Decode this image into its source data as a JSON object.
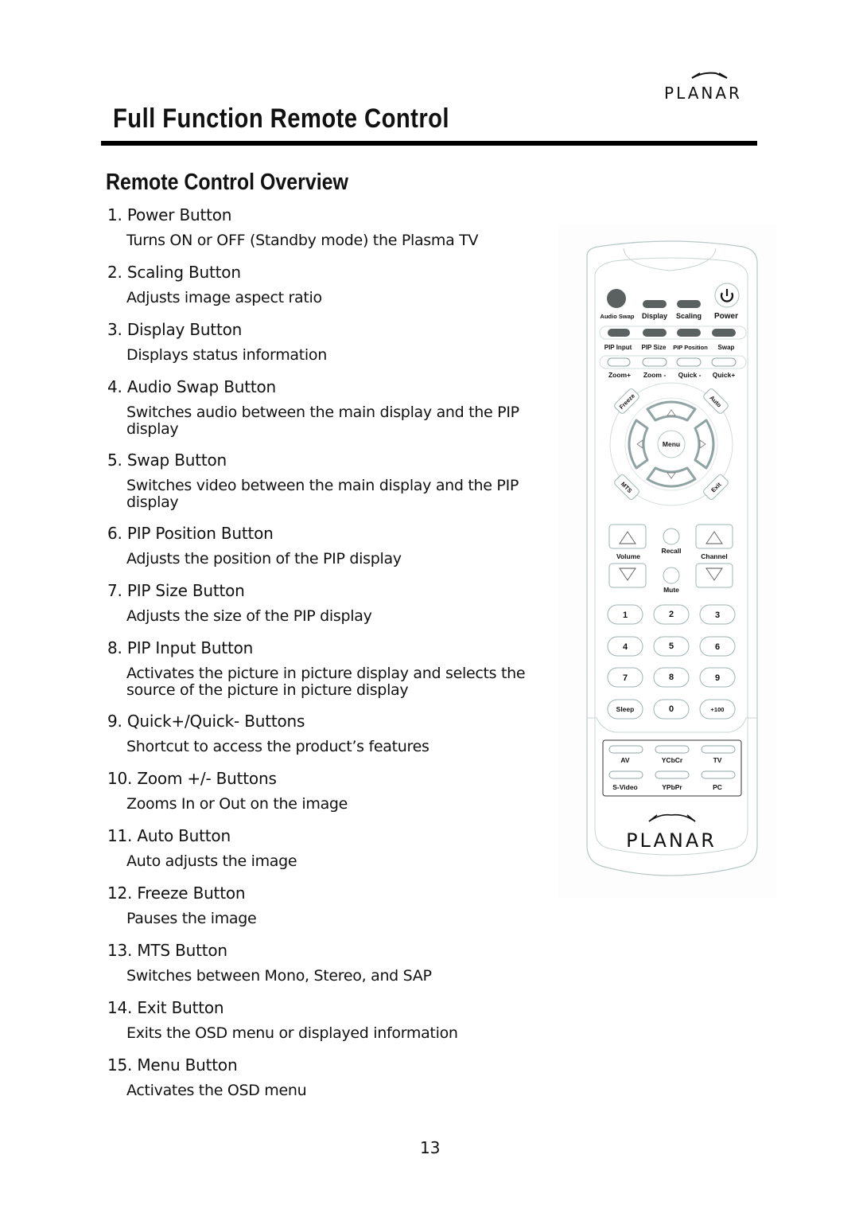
{
  "header": {
    "brand": "PLANAR",
    "title": "Full Function Remote Control"
  },
  "section": {
    "title": "Remote Control Overview"
  },
  "items": [
    {
      "heading": "1. Power Button",
      "description": "Turns ON or OFF (Standby mode) the Plasma TV"
    },
    {
      "heading": "2. Scaling Button",
      "description": "Adjusts image aspect ratio"
    },
    {
      "heading": "3. Display Button",
      "description": "Displays status information"
    },
    {
      "heading": "4. Audio Swap Button",
      "description": "Switches audio between the main display and the PIP\ndisplay"
    },
    {
      "heading": "5. Swap Button",
      "description": "Switches video between the main display and the PIP\ndisplay"
    },
    {
      "heading": "6. PIP Position Button",
      "description": "Adjusts the position of the PIP display"
    },
    {
      "heading": "7. PIP Size Button",
      "description": "Adjusts the size of the PIP display"
    },
    {
      "heading": "8. PIP Input Button",
      "description": "Activates the picture in picture display and selects the\nsource of the picture in picture display"
    },
    {
      "heading": "9. Quick+/Quick- Buttons",
      "description": "Shortcut to access the product’s features"
    },
    {
      "heading": "10. Zoom +/- Buttons",
      "description": "Zooms In or Out on the image"
    },
    {
      "heading": "11. Auto Button",
      "description": "Auto adjusts the image"
    },
    {
      "heading": "12. Freeze Button",
      "description": "Pauses the image"
    },
    {
      "heading": "13. MTS Button",
      "description": "Switches between Mono, Stereo, and SAP"
    },
    {
      "heading": "14. Exit Button",
      "description": "Exits the OSD menu or displayed information"
    },
    {
      "heading": "15. Menu Button",
      "description": "Activates the OSD menu"
    }
  ],
  "remote": {
    "top_row": [
      "Audio Swap",
      "Display",
      "Scaling",
      "Power"
    ],
    "pip_row": [
      "PIP Input",
      "PIP Size",
      "PIP Position",
      "Swap"
    ],
    "zoom_row": [
      "Zoom+",
      "Zoom -",
      "Quick -",
      "Quick+"
    ],
    "dpad": {
      "center": "Menu",
      "corners": [
        "Freeze",
        "Auto",
        "MTS",
        "Exit"
      ]
    },
    "volume_label": "Volume",
    "channel_label": "Channel",
    "recall_label": "Recall",
    "mute_label": "Mute",
    "keypad": [
      "1",
      "2",
      "3",
      "4",
      "5",
      "6",
      "7",
      "8",
      "9",
      "Sleep",
      "0",
      "+100"
    ],
    "source_row1": [
      "AV",
      "YCbCr",
      "TV"
    ],
    "source_row2": [
      "S-Video",
      "YPbPr",
      "PC"
    ],
    "brand": "PLANAR"
  },
  "colors": {
    "dark_button": "#5a6160",
    "outline": "#9fb3b3",
    "text": "#111111"
  },
  "footer": {
    "page_number": "13"
  }
}
